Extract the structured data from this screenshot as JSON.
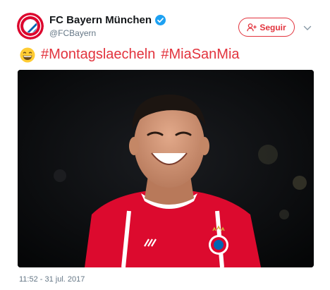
{
  "account": {
    "display_name": "FC Bayern München",
    "handle": "@FCBayern",
    "avatar_icon": "fc-bayern-crest",
    "verified": true
  },
  "follow_button": {
    "label": "Seguir",
    "icon": "add-user-icon"
  },
  "more_icon": "chevron-down-icon",
  "tweet": {
    "emoji": "grinning-face-emoji",
    "hashtags": [
      "#Montagslaecheln",
      "#MiaSanMia"
    ]
  },
  "media": {
    "description_icon": "photo"
  },
  "timestamp": "11:52 - 31 jul. 2017",
  "colors": {
    "brand_red": "#e2333d",
    "secondary_text": "#657786",
    "verified_blue": "#1da1f2"
  }
}
